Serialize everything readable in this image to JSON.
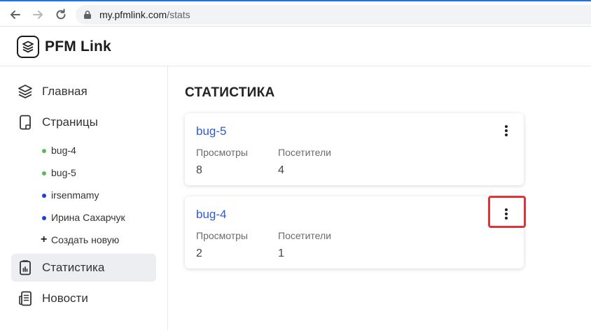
{
  "browser": {
    "url_host": "my.pfmlink.com",
    "url_path": "/stats",
    "icons": [
      "back-arrow-icon",
      "forward-arrow-icon",
      "reload-icon",
      "lock-icon"
    ]
  },
  "app": {
    "name": "PFM Link",
    "logo_icon": "layers-icon"
  },
  "sidebar": {
    "items": [
      {
        "label": "Главная",
        "icon": "layers-icon",
        "active": false
      },
      {
        "label": "Страницы",
        "icon": "page-icon",
        "active": false
      },
      {
        "label": "Статистика",
        "icon": "stats-icon",
        "active": true
      },
      {
        "label": "Новости",
        "icon": "news-icon",
        "active": false
      }
    ],
    "pages": [
      {
        "label": "bug-4",
        "status_color": "#5cb85c"
      },
      {
        "label": "bug-5",
        "status_color": "#5cb85c"
      },
      {
        "label": "irsenmamy",
        "status_color": "#1f3fd6"
      },
      {
        "label": "Ирина Сахарчук",
        "status_color": "#1f3fd6"
      }
    ],
    "create_label": "Создать новую"
  },
  "main": {
    "title": "СТАТИСТИКА",
    "cards": [
      {
        "name": "bug-5",
        "views_label": "Просмотры",
        "views": "8",
        "visitors_label": "Посетители",
        "visitors": "4"
      },
      {
        "name": "bug-4",
        "views_label": "Просмотры",
        "views": "2",
        "visitors_label": "Посетители",
        "visitors": "1"
      }
    ]
  },
  "colors": {
    "accent_link": "#2f5bd3",
    "highlight": "#d9373b",
    "active_bg": "#eceef1"
  }
}
